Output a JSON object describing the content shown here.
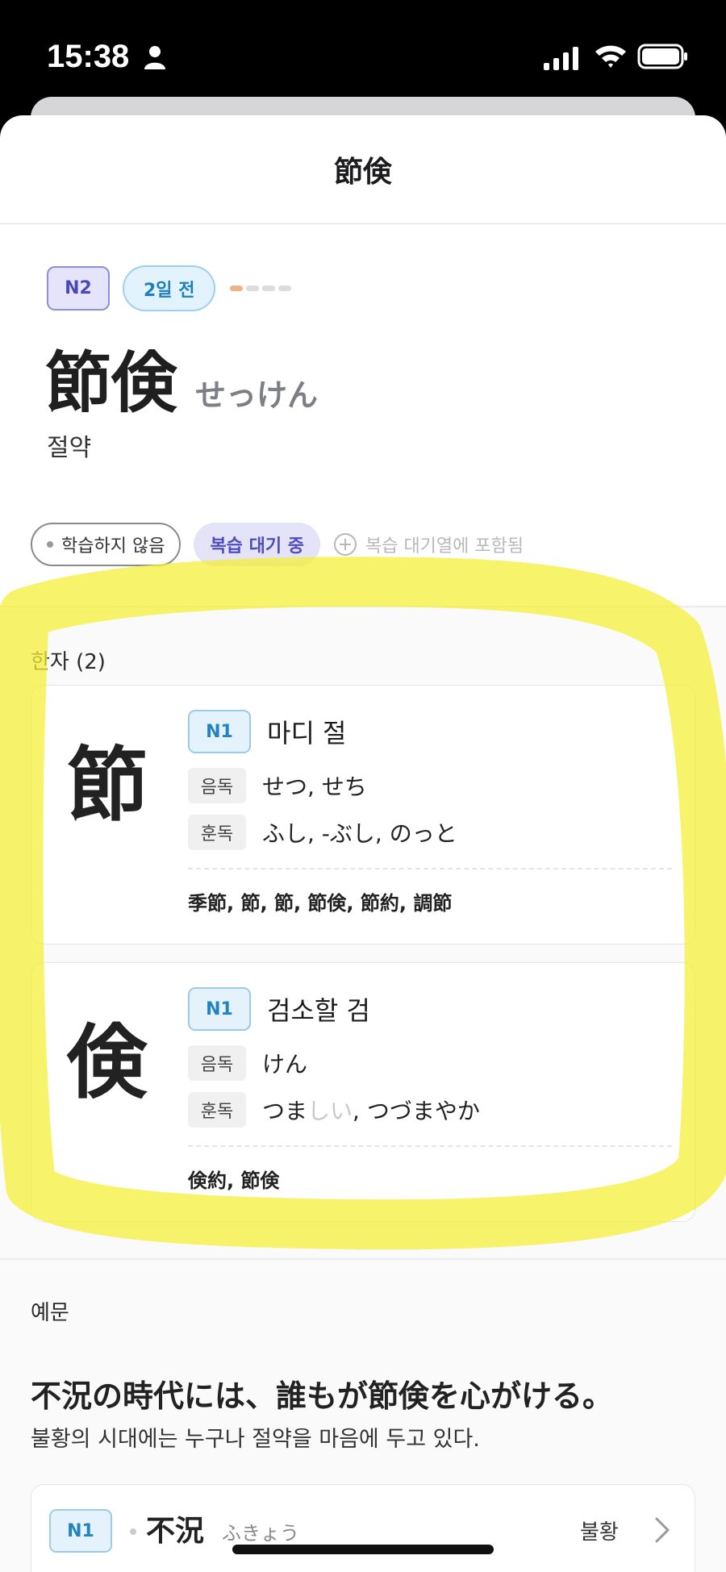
{
  "status_bar": {
    "time": "15:38"
  },
  "nav": {
    "title": "節倹"
  },
  "word": {
    "level": "N2",
    "last_seen": "2일 전",
    "progress": 0.25,
    "kanji": "節倹",
    "reading": "せっけん",
    "meaning": "절약"
  },
  "status_chips": {
    "not_study": "학습하지 않음",
    "review_pending": "복습 대기 중",
    "queue_included": "복습 대기열에 포함됨"
  },
  "kanji_section": {
    "label": "한자 (2)",
    "on_label": "음독",
    "kun_label": "훈독",
    "items": [
      {
        "char": "節",
        "level": "N1",
        "meaning": "마디 절",
        "on": "せつ, せち",
        "kun": "ふし, -ぶし, のっと",
        "compounds": "季節, 節, 節, 節倹, 節約, 調節"
      },
      {
        "char": "倹",
        "level": "N1",
        "meaning": "검소할 검",
        "on": "けん",
        "kun_main": "つま",
        "kun_okurigana": "しい",
        "kun_rest": ", つづまやか",
        "compounds": "倹約, 節倹"
      }
    ]
  },
  "examples": {
    "label": "예문",
    "sentence_jp": "不況の時代には、誰もが節倹を心がける。",
    "sentence_kr": "불황의 시대에는 누구나 절약을 마음에 두고 있다.",
    "vocab": {
      "level": "N1",
      "word": "不況",
      "reading": "ふきょう",
      "meaning": "불황"
    }
  },
  "colors": {
    "highlight": "#f4ef3a",
    "n2_badge": "#4a4ab6",
    "n1_badge": "#2382c0",
    "review_chip": "#4f4dbd"
  }
}
